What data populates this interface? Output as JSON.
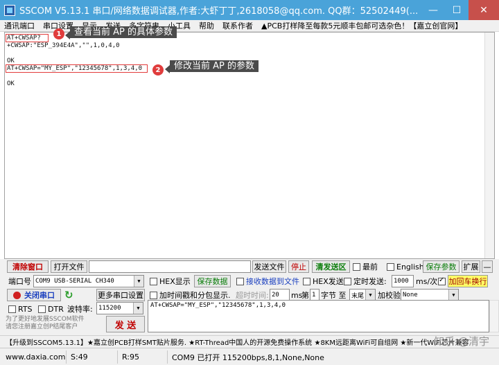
{
  "window": {
    "title": "SSCOM V5.13.1 串口/网络数据调试器,作者:大虾丁丁,2618058@qq.com. QQ群：52502449(...",
    "min": "—",
    "max": "☐",
    "close": "✕"
  },
  "menu": [
    "通讯端口",
    "串口设置",
    "显示",
    "发送",
    "多字符串",
    "小工具",
    "帮助",
    "联系作者",
    "▲PCB打样降至每款5元顺丰包邮可选杂色！【嘉立创官网】"
  ],
  "receive": {
    "lines": [
      "AT+CWSAP?",
      "+CWSAP:\"ESP_394E4A\",\"\",1,0,4,0",
      "",
      "OK",
      "AT+CWSAP=\"MY_ESP\",\"12345678\",1,3,4,0",
      "",
      "OK"
    ],
    "callouts": [
      {
        "num": "1",
        "text": "查看当前 AP 的具体参数"
      },
      {
        "num": "2",
        "text": "修改当前 AP 的参数"
      }
    ]
  },
  "controls": {
    "clear_window": "清除窗口",
    "open_file": "打开文件",
    "file_path": "",
    "send_file": "发送文件",
    "stop": "停止",
    "clear_send": "清发送区",
    "topmost": "最前",
    "english": "English",
    "save_params": "保存参数",
    "expand": "扩展",
    "collapse": "—",
    "port_label": "端口号",
    "port_value": "COM9 USB-SERIAL CH340",
    "hex_display": "HEX显示",
    "save_data": "保存数据",
    "recv_to_file": "接收数据到文件",
    "hex_send": "HEX发送",
    "timed_send": "定时发送:",
    "interval": "1000",
    "interval_unit": "ms/次",
    "append_crlf": "加回车换行",
    "close_port": "关闭串口",
    "more_settings": "更多串口设置",
    "timestamp": "加时间戳和分包显示.",
    "timeout_label": "超时时间:",
    "timeout_value": "20",
    "timeout_unit": "ms",
    "nth_label": "第",
    "nth_value": "1",
    "byte_label": "字节 至",
    "end_value": "末尾",
    "checksum_label": "加校验",
    "checksum_value": "None",
    "rts": "RTS",
    "dtr": "DTR",
    "baud_label": "波特率:",
    "baud_value": "115200",
    "send_text": "AT+CWSAP=\"MY_ESP\",\"12345678\",1,3,4,0",
    "promo": "为了更好地发展SSCOM软件\n请您注册嘉立创P结尾客户",
    "send": "发 送"
  },
  "ad_text": "【升级到SSCOM5.13.1】★嘉立创PCB打样SMT贴片服务. ★RT-Thread中国人的开源免费操作系统 ★8KM远距离WiFi可自组网 ★新一代WiFi芯片兼容",
  "status": {
    "site": "www.daxia.com",
    "sent": "S:49",
    "recv": "R:95",
    "port_status": "COM9 已打开  115200bps,8,1,None,None"
  },
  "watermark": "知乎 @清宇"
}
